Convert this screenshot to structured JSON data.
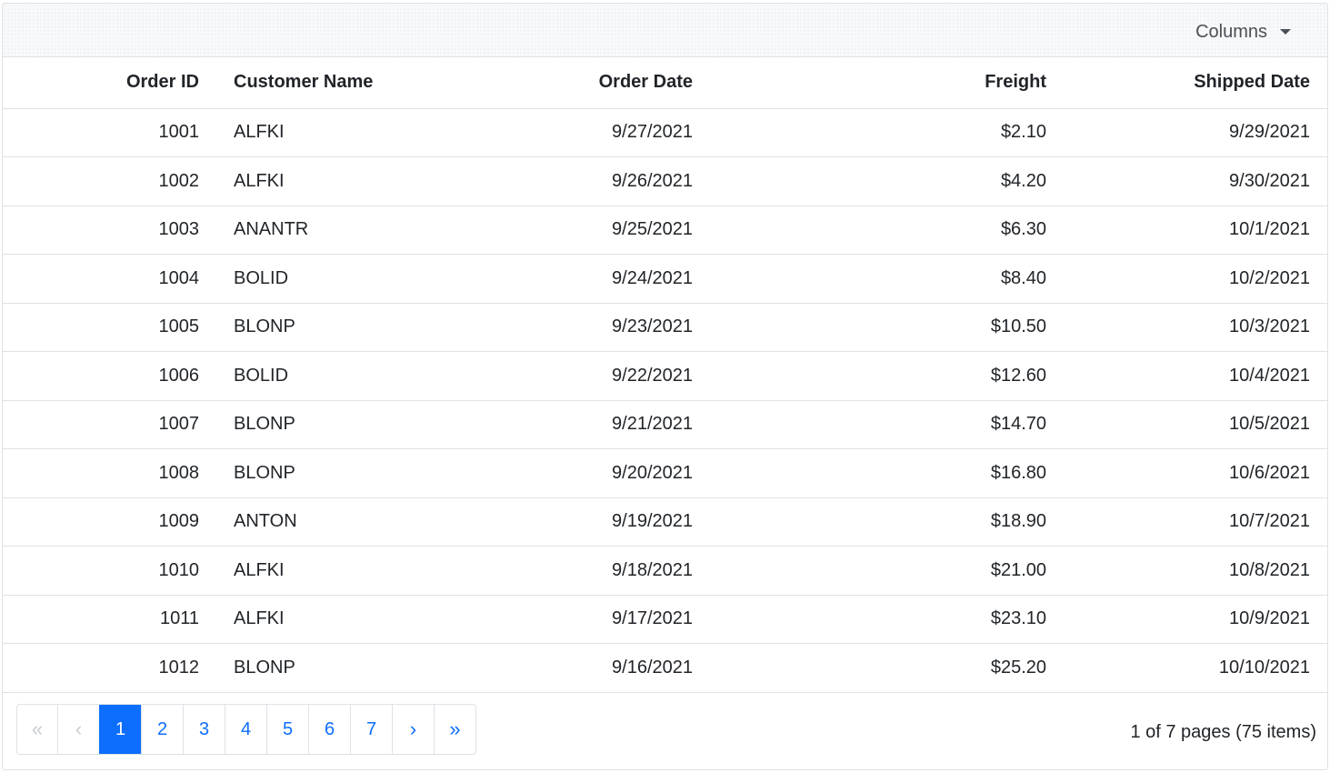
{
  "toolbar": {
    "columns_label": "Columns"
  },
  "table": {
    "headers": {
      "order_id": "Order ID",
      "customer_name": "Customer Name",
      "order_date": "Order Date",
      "freight": "Freight",
      "shipped_date": "Shipped Date"
    },
    "rows": [
      {
        "order_id": "1001",
        "customer_name": "ALFKI",
        "order_date": "9/27/2021",
        "freight": "$2.10",
        "shipped_date": "9/29/2021"
      },
      {
        "order_id": "1002",
        "customer_name": "ALFKI",
        "order_date": "9/26/2021",
        "freight": "$4.20",
        "shipped_date": "9/30/2021"
      },
      {
        "order_id": "1003",
        "customer_name": "ANANTR",
        "order_date": "9/25/2021",
        "freight": "$6.30",
        "shipped_date": "10/1/2021"
      },
      {
        "order_id": "1004",
        "customer_name": "BOLID",
        "order_date": "9/24/2021",
        "freight": "$8.40",
        "shipped_date": "10/2/2021"
      },
      {
        "order_id": "1005",
        "customer_name": "BLONP",
        "order_date": "9/23/2021",
        "freight": "$10.50",
        "shipped_date": "10/3/2021"
      },
      {
        "order_id": "1006",
        "customer_name": "BOLID",
        "order_date": "9/22/2021",
        "freight": "$12.60",
        "shipped_date": "10/4/2021"
      },
      {
        "order_id": "1007",
        "customer_name": "BLONP",
        "order_date": "9/21/2021",
        "freight": "$14.70",
        "shipped_date": "10/5/2021"
      },
      {
        "order_id": "1008",
        "customer_name": "BLONP",
        "order_date": "9/20/2021",
        "freight": "$16.80",
        "shipped_date": "10/6/2021"
      },
      {
        "order_id": "1009",
        "customer_name": "ANTON",
        "order_date": "9/19/2021",
        "freight": "$18.90",
        "shipped_date": "10/7/2021"
      },
      {
        "order_id": "1010",
        "customer_name": "ALFKI",
        "order_date": "9/18/2021",
        "freight": "$21.00",
        "shipped_date": "10/8/2021"
      },
      {
        "order_id": "1011",
        "customer_name": "ALFKI",
        "order_date": "9/17/2021",
        "freight": "$23.10",
        "shipped_date": "10/9/2021"
      },
      {
        "order_id": "1012",
        "customer_name": "BLONP",
        "order_date": "9/16/2021",
        "freight": "$25.20",
        "shipped_date": "10/10/2021"
      }
    ]
  },
  "pager": {
    "first_icon": "«",
    "prev_icon": "‹",
    "next_icon": "›",
    "last_icon": "»",
    "pages": [
      "1",
      "2",
      "3",
      "4",
      "5",
      "6",
      "7"
    ],
    "current_page": "1",
    "info": "1 of 7 pages (75 items)"
  },
  "colors": {
    "accent": "#0d6efd",
    "border": "#dee2e6",
    "toolbar_bg": "#f8f9fa"
  }
}
